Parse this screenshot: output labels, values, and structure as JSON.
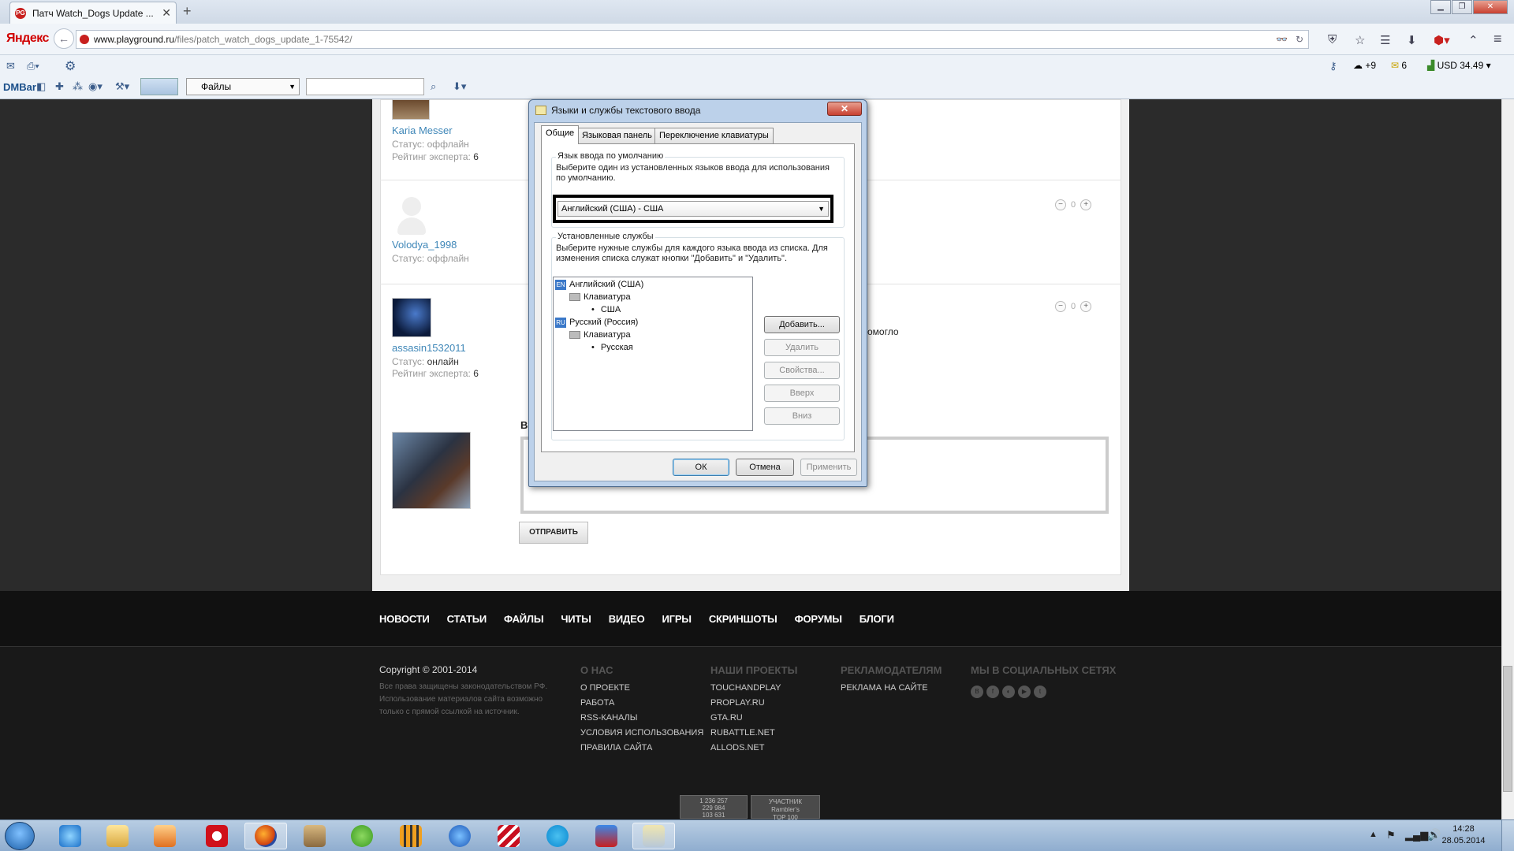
{
  "browser": {
    "tab_title": "Патч Watch_Dogs Update ...",
    "tab_favicon": "PG",
    "new_tab": "+",
    "tab_close": "✕",
    "brand": "Яндекс",
    "url_domain": "www.playground.ru",
    "url_path": "/files/patch_watch_dogs_update_1-75542/",
    "weather": "+9",
    "mail_count": "6",
    "currency": "USD 34.49"
  },
  "toolbar": {
    "dmbar": "DMBar",
    "files_select": "Файлы"
  },
  "users": [
    {
      "name": "Karia Messer",
      "status_label": "Статус:",
      "status": "оффлайн",
      "rating_label": "Рейтинг эксперта:",
      "rating": "6"
    },
    {
      "name": "Volodya_1998",
      "status_label": "Статус:",
      "status": "оффлайн"
    },
    {
      "name": "assasin1532011",
      "status_label": "Статус:",
      "status": "онлайн",
      "rating_label": "Рейтинг эксперта:",
      "rating": "6"
    }
  ],
  "votes": [
    {
      "minus": "−",
      "count": "0",
      "plus": "+"
    },
    {
      "minus": "−",
      "count": "0",
      "plus": "+"
    }
  ],
  "comment_fragment": "омогло",
  "comment_heading_fragment": "В",
  "send_button": "ОТПРАВИТЬ",
  "nav": [
    "НОВОСТИ",
    "СТАТЬИ",
    "ФАЙЛЫ",
    "ЧИТЫ",
    "ВИДЕО",
    "ИГРЫ",
    "СКРИНШОТЫ",
    "ФОРУМЫ",
    "БЛОГИ"
  ],
  "footer": {
    "copyright": "Copyright © 2001-2014",
    "rights": "Все права защищены законодательством РФ. Использование материалов сайта возможно только с прямой ссылкой на источник.",
    "about_title": "О НАС",
    "about_links": [
      "О ПРОЕКТЕ",
      "РАБОТА",
      "RSS-КАНАЛЫ",
      "УСЛОВИЯ ИСПОЛЬЗОВАНИЯ",
      "ПРАВИЛА САЙТА"
    ],
    "projects_title": "НАШИ ПРОЕКТЫ",
    "projects_links": [
      "TOUCHANDPLAY",
      "PROPLAY.RU",
      "GTA.RU",
      "RUBATTLE.NET",
      "ALLODS.NET"
    ],
    "ads_title": "РЕКЛАМОДАТЕЛЯМ",
    "ads_links": [
      "РЕКЛАМА НА САЙТЕ"
    ],
    "social_title": "МЫ В СОЦИАЛЬНЫХ СЕТЯХ",
    "counter_lines": [
      "1 236 257",
      "229 984",
      "103 631"
    ],
    "rambler_label": "УЧАСТНИК",
    "rambler_name": "Rambler's",
    "rambler_top": "TOP 100"
  },
  "dialog": {
    "title": "Языки и службы текстового ввода",
    "close": "✕",
    "tabs": [
      "Общие",
      "Языковая панель",
      "Переключение клавиатуры"
    ],
    "default_group": "Язык ввода по умолчанию",
    "default_desc": "Выберите один из установленных языков ввода для использования по умолчанию.",
    "default_value": "Английский (США) - США",
    "services_group": "Установленные службы",
    "services_desc": "Выберите нужные службы для каждого языка ввода из списка. Для изменения списка служат кнопки \"Добавить\" и \"Удалить\".",
    "tree": [
      {
        "badge": "EN",
        "label": "Английский (США)",
        "kbd": "Клавиатура",
        "layout": "США"
      },
      {
        "badge": "RU",
        "label": "Русский (Россия)",
        "kbd": "Клавиатура",
        "layout": "Русская"
      }
    ],
    "buttons": {
      "add": "Добавить...",
      "remove": "Удалить",
      "props": "Свойства...",
      "up": "Вверх",
      "down": "Вниз"
    },
    "ok": "ОК",
    "cancel": "Отмена",
    "apply": "Применить"
  },
  "taskbar": {
    "time": "14:28",
    "date": "28.05.2014"
  }
}
